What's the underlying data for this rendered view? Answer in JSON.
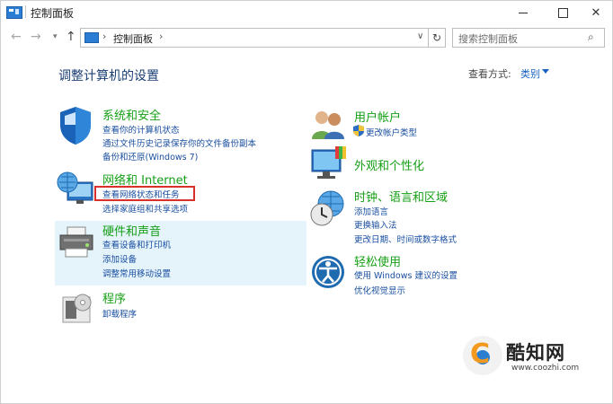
{
  "window": {
    "title": "控制面板"
  },
  "address": {
    "path": "控制面板",
    "search_placeholder": "搜索控制面板"
  },
  "main": {
    "title": "调整计算机的设置",
    "view_by_label": "查看方式:",
    "view_by_value": "类别"
  },
  "categories": {
    "system": {
      "title": "系统和安全",
      "links": [
        "查看你的计算机状态",
        "通过文件历史记录保存你的文件备份副本",
        "备份和还原(Windows 7)"
      ]
    },
    "network": {
      "title": "网络和 Internet",
      "links": [
        "查看网络状态和任务",
        "选择家庭组和共享选项"
      ]
    },
    "hardware": {
      "title": "硬件和声音",
      "links": [
        "查看设备和打印机",
        "添加设备",
        "调整常用移动设置"
      ]
    },
    "programs": {
      "title": "程序",
      "links": [
        "卸载程序"
      ]
    },
    "accounts": {
      "title": "用户帐户",
      "links": [
        "更改帐户类型"
      ]
    },
    "appearance": {
      "title": "外观和个性化"
    },
    "clock": {
      "title": "时钟、语言和区域",
      "links": [
        "添加语言",
        "更换输入法",
        "更改日期、时间或数字格式"
      ]
    },
    "ease": {
      "title": "轻松使用",
      "links": [
        "使用 Windows 建议的设置",
        "优化视觉显示"
      ]
    }
  },
  "watermark": {
    "name": "酷知网",
    "url": "www.coozhi.com"
  }
}
